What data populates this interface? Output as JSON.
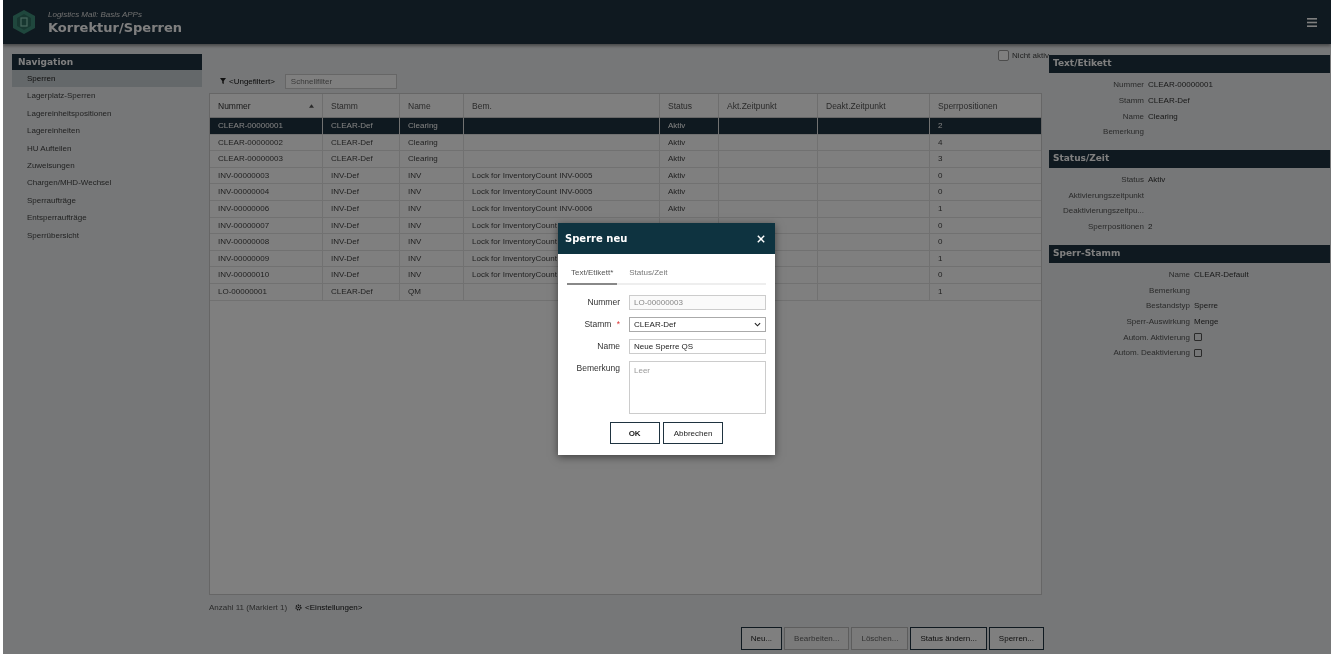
{
  "header": {
    "subtitle": "Logistics Mall: Basis APPs",
    "title": "Korrektur/Sperren"
  },
  "navigation": {
    "title": "Navigation",
    "items": [
      {
        "label": "Sperren",
        "selected": true
      },
      {
        "label": "Lagerplatz-Sperren",
        "selected": false
      },
      {
        "label": "Lagereinheitspositionen",
        "selected": false
      },
      {
        "label": "Lagereinheiten",
        "selected": false
      },
      {
        "label": "HU Aufteilen",
        "selected": false
      },
      {
        "label": "Zuweisungen",
        "selected": false
      },
      {
        "label": "Chargen/MHD-Wechsel",
        "selected": false
      },
      {
        "label": "Sperraufträge",
        "selected": false
      },
      {
        "label": "Entsperraufträge",
        "selected": false
      },
      {
        "label": "Sperrübersicht",
        "selected": false
      }
    ]
  },
  "filter": {
    "label": "<Ungefiltert>",
    "placeholder": "Schnellfilter"
  },
  "inactive_toggle": {
    "label": "Nicht aktiv",
    "checked": false
  },
  "table": {
    "columns": [
      {
        "label": "Nummer",
        "sorted": true
      },
      {
        "label": "Stamm",
        "sorted": false
      },
      {
        "label": "Name",
        "sorted": false
      },
      {
        "label": "Bem.",
        "sorted": false
      },
      {
        "label": "Status",
        "sorted": false
      },
      {
        "label": "Akt.Zeitpunkt",
        "sorted": false
      },
      {
        "label": "Deakt.Zeitpunkt",
        "sorted": false
      },
      {
        "label": "Sperrpositionen",
        "sorted": false
      }
    ],
    "rows": [
      {
        "cells": [
          "CLEAR-00000001",
          "CLEAR-Def",
          "Clearing",
          null,
          "Aktiv",
          null,
          null,
          "2"
        ],
        "selected": true
      },
      {
        "cells": [
          "CLEAR-00000002",
          "CLEAR-Def",
          "Clearing",
          null,
          "Aktiv",
          null,
          null,
          "4"
        ],
        "selected": false
      },
      {
        "cells": [
          "CLEAR-00000003",
          "CLEAR-Def",
          "Clearing",
          null,
          "Aktiv",
          null,
          null,
          "3"
        ],
        "selected": false
      },
      {
        "cells": [
          "INV-00000003",
          "INV-Def",
          "INV",
          "Lock for InventoryCount INV-0005",
          "Aktiv",
          null,
          null,
          "0"
        ],
        "selected": false
      },
      {
        "cells": [
          "INV-00000004",
          "INV-Def",
          "INV",
          "Lock for InventoryCount INV-0005",
          "Aktiv",
          null,
          null,
          "0"
        ],
        "selected": false
      },
      {
        "cells": [
          "INV-00000006",
          "INV-Def",
          "INV",
          "Lock for InventoryCount INV-0006",
          "Aktiv",
          null,
          null,
          "1"
        ],
        "selected": false
      },
      {
        "cells": [
          "INV-00000007",
          "INV-Def",
          "INV",
          "Lock for InventoryCount",
          null,
          null,
          null,
          "0"
        ],
        "selected": false
      },
      {
        "cells": [
          "INV-00000008",
          "INV-Def",
          "INV",
          "Lock for InventoryCount",
          null,
          null,
          null,
          "0"
        ],
        "selected": false
      },
      {
        "cells": [
          "INV-00000009",
          "INV-Def",
          "INV",
          "Lock for InventoryCount",
          null,
          null,
          null,
          "1"
        ],
        "selected": false
      },
      {
        "cells": [
          "INV-00000010",
          "INV-Def",
          "INV",
          "Lock for InventoryCount",
          null,
          null,
          null,
          "0"
        ],
        "selected": false
      },
      {
        "cells": [
          "LO-00000001",
          "CLEAR-Def",
          "QM",
          null,
          null,
          null,
          null,
          "1"
        ],
        "selected": false
      }
    ]
  },
  "footer": {
    "count": "Anzahl 11 (Markiert 1)",
    "settings": "<Einstellungen>"
  },
  "buttons": [
    {
      "label": "Neu...",
      "disabled": false
    },
    {
      "label": "Bearbeiten...",
      "disabled": true
    },
    {
      "label": "Löschen...",
      "disabled": true
    },
    {
      "label": "Status ändern...",
      "disabled": false
    },
    {
      "label": "Sperren...",
      "disabled": false
    }
  ],
  "details": [
    {
      "title": "Text/Etikett",
      "fields": [
        {
          "kind": "text",
          "label": "Nummer",
          "value": "CLEAR-00000001"
        },
        {
          "kind": "text",
          "label": "Stamm",
          "value": "CLEAR-Def"
        },
        {
          "kind": "text",
          "label": "Name",
          "value": "Clearing"
        },
        {
          "kind": "text",
          "label": "Bemerkung"
        }
      ]
    },
    {
      "title": "Status/Zeit",
      "fields": [
        {
          "kind": "text",
          "label": "Status",
          "value": "Aktiv"
        },
        {
          "kind": "text",
          "label": "Aktivierungszeitpunkt"
        },
        {
          "kind": "text",
          "label": "Deaktivierungszeitpu..."
        },
        {
          "kind": "text",
          "label": "Sperrpositionen",
          "value": "2"
        }
      ]
    },
    {
      "title": "Sperr-Stamm",
      "fields": [
        {
          "kind": "text",
          "label": "Name",
          "value": "CLEAR-Default"
        },
        {
          "kind": "text",
          "label": "Bemerkung"
        },
        {
          "kind": "text",
          "label": "Bestandstyp",
          "value": "Sperre"
        },
        {
          "kind": "text",
          "label": "Sperr-Auswirkung",
          "value": "Menge"
        },
        {
          "kind": "checkbox",
          "label": "Autom. Aktivierung",
          "checked": false
        },
        {
          "kind": "checkbox",
          "label": "Autom. Deaktivierung",
          "checked": false
        }
      ]
    }
  ],
  "dialog": {
    "title": "Sperre neu",
    "tabs": [
      {
        "label": "Text/Etikett*",
        "selected": true
      },
      {
        "label": "Status/Zeit",
        "selected": false
      }
    ],
    "fields": [
      {
        "kind": "input",
        "label": "Nummer",
        "value": "LO-00000003",
        "disabled": true
      },
      {
        "kind": "select",
        "label": "Stamm",
        "required_mark": "*",
        "value": "CLEAR-Def",
        "disabled": false
      },
      {
        "kind": "input",
        "label": "Name",
        "value": "Neue Sperre QS",
        "disabled": false
      },
      {
        "kind": "textarea",
        "label": "Bemerkung",
        "placeholder": "Leer",
        "disabled": false
      }
    ],
    "buttons": [
      {
        "label": "OK",
        "default": true
      },
      {
        "label": "Abbrechen",
        "default": false
      }
    ]
  }
}
